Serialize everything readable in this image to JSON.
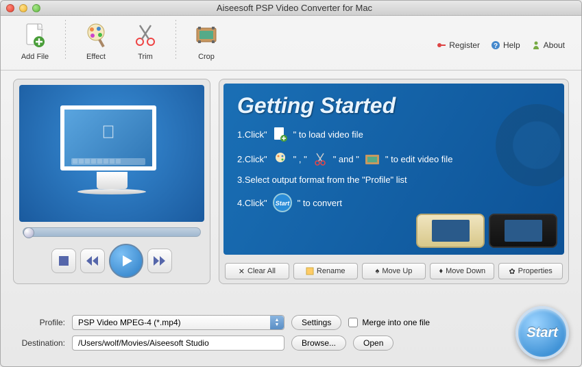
{
  "window": {
    "title": "Aiseesoft PSP Video Converter for Mac"
  },
  "toolbar": {
    "addFile": "Add File",
    "effect": "Effect",
    "trim": "Trim",
    "crop": "Crop"
  },
  "links": {
    "register": "Register",
    "help": "Help",
    "about": "About"
  },
  "gettingStarted": {
    "title": "Getting Started",
    "step1a": "1.Click\"",
    "step1b": "\" to load video file",
    "step2a": "2.Click\"",
    "step2b": "\" , \"",
    "step2c": "\" and \"",
    "step2d": "\" to edit video file",
    "step3": "3.Select output format from the \"Profile\" list",
    "step4a": "4.Click\"",
    "step4b": "\" to convert"
  },
  "actions": {
    "clearAll": "Clear All",
    "rename": "Rename",
    "moveUp": "Move Up",
    "moveDown": "Move Down",
    "properties": "Properties"
  },
  "form": {
    "profileLabel": "Profile:",
    "profileValue": "PSP Video MPEG-4 (*.mp4)",
    "settings": "Settings",
    "merge": "Merge into one file",
    "destLabel": "Destination:",
    "destValue": "/Users/wolf/Movies/Aiseesoft Studio",
    "browse": "Browse...",
    "open": "Open"
  },
  "start": "Start"
}
